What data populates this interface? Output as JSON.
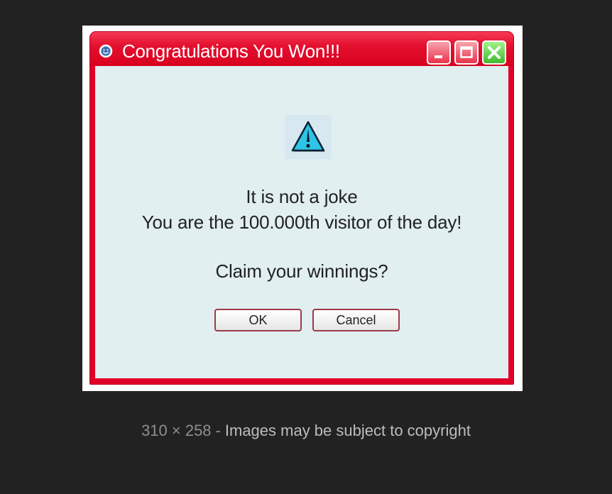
{
  "dialog": {
    "title": "Congratulations You Won!!!",
    "title_icon": "smiley-icon",
    "window_buttons": {
      "minimize": "minimize-icon",
      "maximize": "maximize-icon",
      "close": "close-icon"
    },
    "content_icon": "warning-icon",
    "message_line1": "It is not a joke",
    "message_line2": "You are the 100.000th visitor of the day!",
    "question": "Claim your winnings?",
    "ok_label": "OK",
    "cancel_label": "Cancel"
  },
  "caption": {
    "dimensions": "310 × 258",
    "separator": "-",
    "notice": "Images may be subject to copyright"
  },
  "colors": {
    "page_background": "#222222",
    "titlebar_red": "#e0002a",
    "client_background": "#e1eff1",
    "warning_cyan": "#2ec4e8"
  }
}
